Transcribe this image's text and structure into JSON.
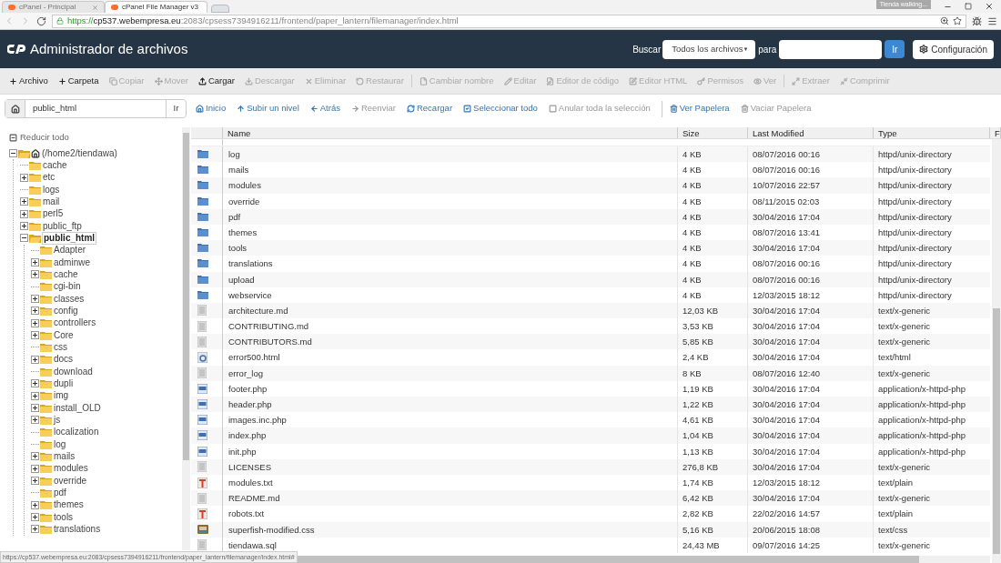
{
  "browser": {
    "tabs": [
      {
        "title": "cPanel - Principal",
        "selected": false
      },
      {
        "title": "cPanel File Manager v3",
        "selected": true
      }
    ],
    "url": {
      "scheme": "https://",
      "host": "cp537.webempresa.eu",
      "rest": ":2083/cpsess7394916211/frontend/paper_lantern/filemanager/index.html"
    },
    "profile": "Tienda walking..."
  },
  "header": {
    "title": "Administrador de archivos",
    "search_label": "Buscar",
    "scope": "Todos los archivos",
    "scope_caret": "▼",
    "for_label": "para",
    "go": "Ir",
    "settings": "Configuración"
  },
  "toolbar": {
    "groups": [
      [
        {
          "label": "Archivo",
          "disabled": false
        },
        {
          "label": "Carpeta",
          "disabled": false
        },
        {
          "label": "Copiar",
          "disabled": true
        },
        {
          "label": "Mover",
          "disabled": true
        },
        {
          "label": "Cargar",
          "disabled": false
        },
        {
          "label": "Descargar",
          "disabled": true
        },
        {
          "label": "Eliminar",
          "disabled": true
        },
        {
          "label": "Restaurar",
          "disabled": true
        }
      ],
      [
        {
          "label": "Cambiar nombre",
          "disabled": true
        },
        {
          "label": "Editar",
          "disabled": true
        },
        {
          "label": "Editor de código",
          "disabled": true
        },
        {
          "label": "Editor HTML",
          "disabled": true
        },
        {
          "label": "Permisos",
          "disabled": true
        },
        {
          "label": "Ver",
          "disabled": true
        }
      ],
      [
        {
          "label": "Extraer",
          "disabled": true
        },
        {
          "label": "Comprimir",
          "disabled": true
        }
      ]
    ]
  },
  "path": {
    "value": "public_html",
    "go": "Ir"
  },
  "nav": {
    "groups": [
      [
        {
          "label": "Inicio",
          "disabled": false
        },
        {
          "label": "Subir un nivel",
          "disabled": false
        },
        {
          "label": "Atrás",
          "disabled": false
        },
        {
          "label": "Reenviar",
          "disabled": true
        },
        {
          "label": "Recargar",
          "disabled": false
        },
        {
          "label": "Seleccionar todo",
          "disabled": false
        },
        {
          "label": "Anular toda la selección",
          "disabled": true
        }
      ],
      [
        {
          "label": "Ver Papelera",
          "disabled": false
        },
        {
          "label": "Vaciar Papelera",
          "disabled": true
        }
      ]
    ]
  },
  "sidebar": {
    "collapse_all": "Reducir todo",
    "tree": [
      {
        "label": "(/home2/tiendawa)",
        "kind": "home",
        "expanded": true,
        "selected": false,
        "children": [
          {
            "label": "cache",
            "selected": false
          },
          {
            "label": "etc",
            "expanded": false,
            "selected": false
          },
          {
            "label": "logs",
            "selected": false
          },
          {
            "label": "mail",
            "expanded": false,
            "selected": false
          },
          {
            "label": "perl5",
            "expanded": false,
            "selected": false
          },
          {
            "label": "public_ftp",
            "expanded": false,
            "selected": false
          },
          {
            "label": "public_html",
            "expanded": true,
            "selected": true,
            "children": [
              {
                "label": "Adapter",
                "selected": false
              },
              {
                "label": "adminwe",
                "expanded": false,
                "selected": false
              },
              {
                "label": "cache",
                "expanded": false,
                "selected": false
              },
              {
                "label": "cgi-bin",
                "selected": false
              },
              {
                "label": "classes",
                "expanded": false,
                "selected": false
              },
              {
                "label": "config",
                "expanded": false,
                "selected": false
              },
              {
                "label": "controllers",
                "expanded": false,
                "selected": false
              },
              {
                "label": "Core",
                "expanded": false,
                "selected": false
              },
              {
                "label": "css",
                "selected": false
              },
              {
                "label": "docs",
                "expanded": false,
                "selected": false
              },
              {
                "label": "download",
                "selected": false
              },
              {
                "label": "dupli",
                "expanded": false,
                "selected": false
              },
              {
                "label": "img",
                "expanded": false,
                "selected": false
              },
              {
                "label": "install_OLD",
                "expanded": false,
                "selected": false
              },
              {
                "label": "js",
                "expanded": false,
                "selected": false
              },
              {
                "label": "localization",
                "selected": false
              },
              {
                "label": "log",
                "selected": false
              },
              {
                "label": "mails",
                "expanded": false,
                "selected": false
              },
              {
                "label": "modules",
                "expanded": false,
                "selected": false
              },
              {
                "label": "override",
                "expanded": false,
                "selected": false
              },
              {
                "label": "pdf",
                "selected": false
              },
              {
                "label": "themes",
                "expanded": false,
                "selected": false
              },
              {
                "label": "tools",
                "expanded": false,
                "selected": false
              },
              {
                "label": "translations",
                "expanded": false,
                "selected": false
              }
            ]
          }
        ]
      }
    ]
  },
  "table": {
    "columns": [
      "Name",
      "Size",
      "Last Modified",
      "Type",
      "F"
    ],
    "rows": [
      {
        "kind": "folder",
        "name": "log",
        "size": "4 KB",
        "modified": "08/07/2016 00:16",
        "type": "httpd/unix-directory"
      },
      {
        "kind": "folder",
        "name": "mails",
        "size": "4 KB",
        "modified": "08/07/2016 00:16",
        "type": "httpd/unix-directory"
      },
      {
        "kind": "folder",
        "name": "modules",
        "size": "4 KB",
        "modified": "10/07/2016 22:57",
        "type": "httpd/unix-directory"
      },
      {
        "kind": "folder",
        "name": "override",
        "size": "4 KB",
        "modified": "08/11/2015 02:03",
        "type": "httpd/unix-directory"
      },
      {
        "kind": "folder",
        "name": "pdf",
        "size": "4 KB",
        "modified": "30/04/2016 17:04",
        "type": "httpd/unix-directory"
      },
      {
        "kind": "folder",
        "name": "themes",
        "size": "4 KB",
        "modified": "08/07/2016 13:41",
        "type": "httpd/unix-directory"
      },
      {
        "kind": "folder",
        "name": "tools",
        "size": "4 KB",
        "modified": "30/04/2016 17:04",
        "type": "httpd/unix-directory"
      },
      {
        "kind": "folder",
        "name": "translations",
        "size": "4 KB",
        "modified": "08/07/2016 00:16",
        "type": "httpd/unix-directory"
      },
      {
        "kind": "folder",
        "name": "upload",
        "size": "4 KB",
        "modified": "08/07/2016 00:16",
        "type": "httpd/unix-directory"
      },
      {
        "kind": "folder",
        "name": "webservice",
        "size": "4 KB",
        "modified": "12/03/2015 18:12",
        "type": "httpd/unix-directory"
      },
      {
        "kind": "generic",
        "name": "architecture.md",
        "size": "12,03 KB",
        "modified": "30/04/2016 17:04",
        "type": "text/x-generic"
      },
      {
        "kind": "generic",
        "name": "CONTRIBUTING.md",
        "size": "3,53 KB",
        "modified": "30/04/2016 17:04",
        "type": "text/x-generic"
      },
      {
        "kind": "generic",
        "name": "CONTRIBUTORS.md",
        "size": "5,85 KB",
        "modified": "30/04/2016 17:04",
        "type": "text/x-generic"
      },
      {
        "kind": "html",
        "name": "error500.html",
        "size": "2,4 KB",
        "modified": "30/04/2016 17:04",
        "type": "text/html"
      },
      {
        "kind": "generic",
        "name": "error_log",
        "size": "8 KB",
        "modified": "08/07/2016 12:40",
        "type": "text/x-generic"
      },
      {
        "kind": "php",
        "name": "footer.php",
        "size": "1,19 KB",
        "modified": "30/04/2016 17:04",
        "type": "application/x-httpd-php"
      },
      {
        "kind": "php",
        "name": "header.php",
        "size": "1,22 KB",
        "modified": "30/04/2016 17:04",
        "type": "application/x-httpd-php"
      },
      {
        "kind": "php",
        "name": "images.inc.php",
        "size": "4,61 KB",
        "modified": "30/04/2016 17:04",
        "type": "application/x-httpd-php"
      },
      {
        "kind": "php",
        "name": "index.php",
        "size": "1,04 KB",
        "modified": "30/04/2016 17:04",
        "type": "application/x-httpd-php"
      },
      {
        "kind": "php",
        "name": "init.php",
        "size": "1,13 KB",
        "modified": "30/04/2016 17:04",
        "type": "application/x-httpd-php"
      },
      {
        "kind": "generic",
        "name": "LICENSES",
        "size": "276,8 KB",
        "modified": "30/04/2016 17:04",
        "type": "text/x-generic"
      },
      {
        "kind": "text",
        "name": "modules.txt",
        "size": "1,74 KB",
        "modified": "12/03/2015 18:12",
        "type": "text/plain"
      },
      {
        "kind": "generic",
        "name": "README.md",
        "size": "6,42 KB",
        "modified": "30/04/2016 17:04",
        "type": "text/x-generic"
      },
      {
        "kind": "text",
        "name": "robots.txt",
        "size": "2,82 KB",
        "modified": "22/02/2016 14:57",
        "type": "text/plain"
      },
      {
        "kind": "css",
        "name": "superfish-modified.css",
        "size": "5,16 KB",
        "modified": "20/06/2015 18:08",
        "type": "text/css"
      },
      {
        "kind": "generic",
        "name": "tiendawa.sql",
        "size": "24,43 MB",
        "modified": "09/07/2016 14:25",
        "type": "text/x-generic"
      }
    ]
  },
  "status_bar": {
    "link": "https://cp537.webempresa.eu:2083/cpsess7394916211/frontend/paper_lantern/filemanager/index.html#"
  }
}
